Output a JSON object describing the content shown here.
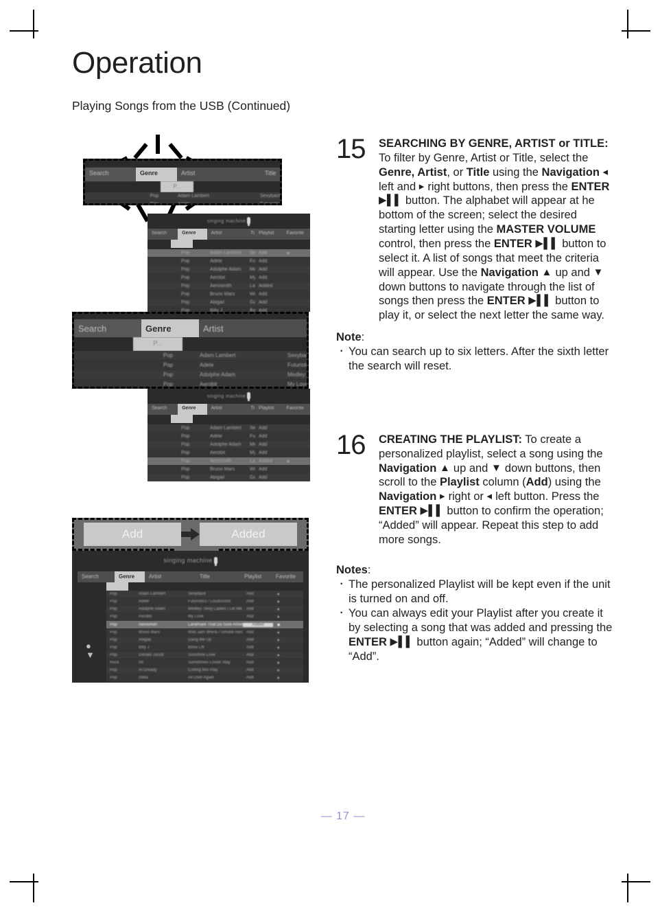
{
  "page": {
    "title": "Operation",
    "subtitle": "Playing Songs from the USB (Continued)",
    "page_number": "— 17 —"
  },
  "steps": [
    {
      "number": "15",
      "heading": "SEARCHING BY GENRE, ARTIST or TITLE:",
      "body_html": "<b>SEARCHING BY GENRE, ARTIST or TITLE:</b> To filter by Genre, Artist or Title, select the <b>Genre, Artist</b>, or <b>Title</b> using the <b>Navigation</b> <span class='nt'>&#9666;</span> left and <span class='nt'>&#9656;</span> right buttons, then press the <b>ENTER</b> <span class='nt'>&#9654;&#9612;&#9612;</span> button. The alphabet will appear at he bottom of the screen; select the desired starting letter using the <b>MASTER VOLUME</b> control, then press the <b>ENTER</b> <span class='nt'>&#9654;&#9612;&#9612;</span> button to select it. A list of songs that meet the criteria will appear. Use the <b>Navigation</b> <span class='nt'>&#9650;</span> up and <span class='nt'>&#9660;</span> down buttons to navigate through the list of songs then press the <b>ENTER</b> <span class='nt'>&#9654;&#9612;&#9612;</span> button to play it, or select the next letter the same way.",
      "note_label": "Note",
      "notes": [
        "You can search up to six letters. After the sixth letter the search will reset."
      ]
    },
    {
      "number": "16",
      "heading": "CREATING THE PLAYLIST:",
      "body_html": "<b>CREATING THE PLAYLIST:</b> To create a personalized playlist, select a song using the <b>Navigation</b> <span class='nt'>&#9650;</span> up and <span class='nt'>&#9660;</span> down buttons, then scroll to the <b>Playlist</b> column (<b>Add</b>) using the <b>Navigation</b> <span class='nt'>&#9656;</span> right or <span class='nt'>&#9666;</span> left button. Press the <b>ENTER</b> <span class='nt'>&#9654;&#9612;&#9612;</span> button to confirm the operation; &ldquo;Added&rdquo; will appear. Repeat this step to add more songs.",
      "note_label": "Notes",
      "notes": [
        "The personalized Playlist will be kept even if the unit is turned on and off.",
        "You can always edit your Playlist after you create it by selecting a song that was added and pressing the ENTER button again; “Added” will change to “Add”."
      ],
      "notes_html": [
        "The personalized Playlist will be kept even if the unit is turned on and off.",
        "You can always edit your Playlist after you create it by selecting a song that was added and pressing the <b>ENTER</b> <span class='nt'>&#9654;&#9612;&#9612;</span> button again; &ldquo;Added&rdquo; will change to &ldquo;Add&rdquo;."
      ]
    }
  ],
  "screens": {
    "logo_text": "singing machine",
    "filter_bar": {
      "columns": [
        "Search",
        "Genre",
        "Artist",
        "Title"
      ],
      "selected_column": "Genre",
      "selected_value": "P..."
    },
    "genre_list": {
      "headers": [
        "Search",
        "Genre",
        "Artist",
        "Title"
      ],
      "rows": [
        {
          "genre": "Pop",
          "artist": "Adam Lambert",
          "title": "Sexyback"
        },
        {
          "genre": "Pop",
          "artist": "Adele",
          "title": "Futuristics / Loudsound"
        },
        {
          "genre": "Pop",
          "artist": "Adolphe Adam",
          "title": "Medley: Sexy Ladies / Let Me Talk to You"
        },
        {
          "genre": "Pop",
          "artist": "Aerobit",
          "title": "My Love"
        }
      ]
    },
    "song_table": {
      "headers": [
        "Search",
        "Genre",
        "Artist",
        "Title",
        "Playlist",
        "Favorite"
      ],
      "playlist_states": [
        "Add",
        "Added"
      ],
      "rows": [
        {
          "genre": "Pop",
          "artist": "Adam Lambert",
          "title": "Sexyback",
          "playlist": "Add"
        },
        {
          "genre": "Pop",
          "artist": "Adele",
          "title": "Futuristics / Loudsound",
          "playlist": "Add"
        },
        {
          "genre": "Pop",
          "artist": "Adolphe Adam",
          "title": "Medley: Sexy Ladies / Let Me Talk to You",
          "playlist": "Add"
        },
        {
          "genre": "Pop",
          "artist": "Aerobit",
          "title": "My Love",
          "playlist": "Add"
        },
        {
          "genre": "Pop",
          "artist": "Aerosmith",
          "title": "Landmark That Do Sure Arrives",
          "playlist": "Added"
        },
        {
          "genre": "Pop",
          "artist": "Bruno Mars",
          "title": "Wild Jam Wreck / Smoke Record",
          "playlist": "Add"
        },
        {
          "genre": "Pop",
          "artist": "Abigail",
          "title": "Gang Me Up",
          "playlist": "Add"
        },
        {
          "genre": "Pop",
          "artist": "Billy J",
          "title": "Bona Lift",
          "playlist": "Add"
        },
        {
          "genre": "Pop",
          "artist": "Donald Jacob",
          "title": "Sunshine Love",
          "playlist": "Add"
        },
        {
          "genre": "Rock",
          "artist": "All",
          "title": "Sometimes Loved Stay",
          "playlist": "Add"
        },
        {
          "genre": "Pop",
          "artist": "Al Gready",
          "title": "Cutting Mix Play",
          "playlist": "Add"
        },
        {
          "genre": "Pop",
          "artist": "Abba",
          "title": "All Over Again",
          "playlist": "Add"
        }
      ]
    }
  },
  "callout": {
    "add_label": "Add",
    "arrow_icon": "right-arrow-icon",
    "added_label": "Added"
  },
  "colors": {
    "text": "#231f20",
    "page_number": "#8d8fd0",
    "screen_bg": "#2b2b2b",
    "header_bar": "#4e4e4e",
    "selected_cell": "#c9c9c9",
    "callout_bg": "#6b6b6b"
  }
}
